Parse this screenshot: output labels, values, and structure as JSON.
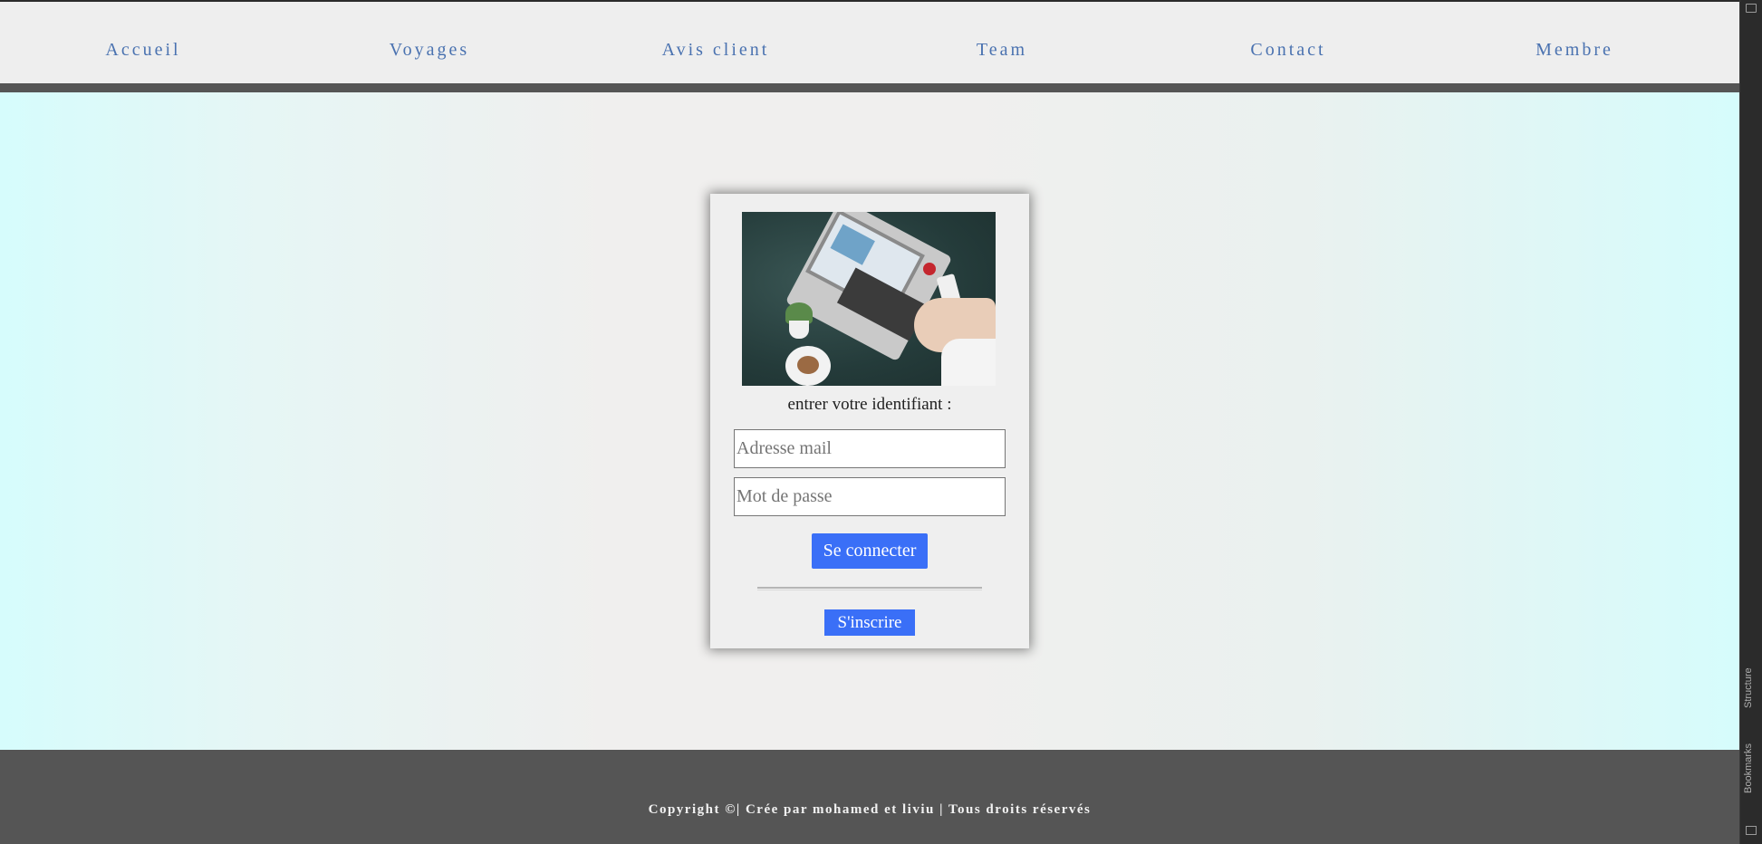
{
  "nav": {
    "items": [
      {
        "label": "Accueil"
      },
      {
        "label": "Voyages"
      },
      {
        "label": "Avis client"
      },
      {
        "label": "Team"
      },
      {
        "label": "Contact"
      },
      {
        "label": "Membre"
      }
    ]
  },
  "login_card": {
    "image_icon": "laptop-desk-photo",
    "prompt": "entrer votre identifiant :",
    "email_placeholder": "Adresse mail",
    "password_placeholder": "Mot de passe",
    "login_button": "Se connecter",
    "signup_button": "S'inscrire"
  },
  "footer": {
    "text": "Copyright ©| Crée par mohamed et liviu | Tous droits réservés"
  },
  "side_panel": {
    "structure_label": "Structure",
    "bookmarks_label": "Bookmarks"
  },
  "colors": {
    "nav_link": "#4a72b0",
    "button": "#3a6ff7",
    "footer_bg": "#555555",
    "nav_bg": "#eeeeee"
  }
}
